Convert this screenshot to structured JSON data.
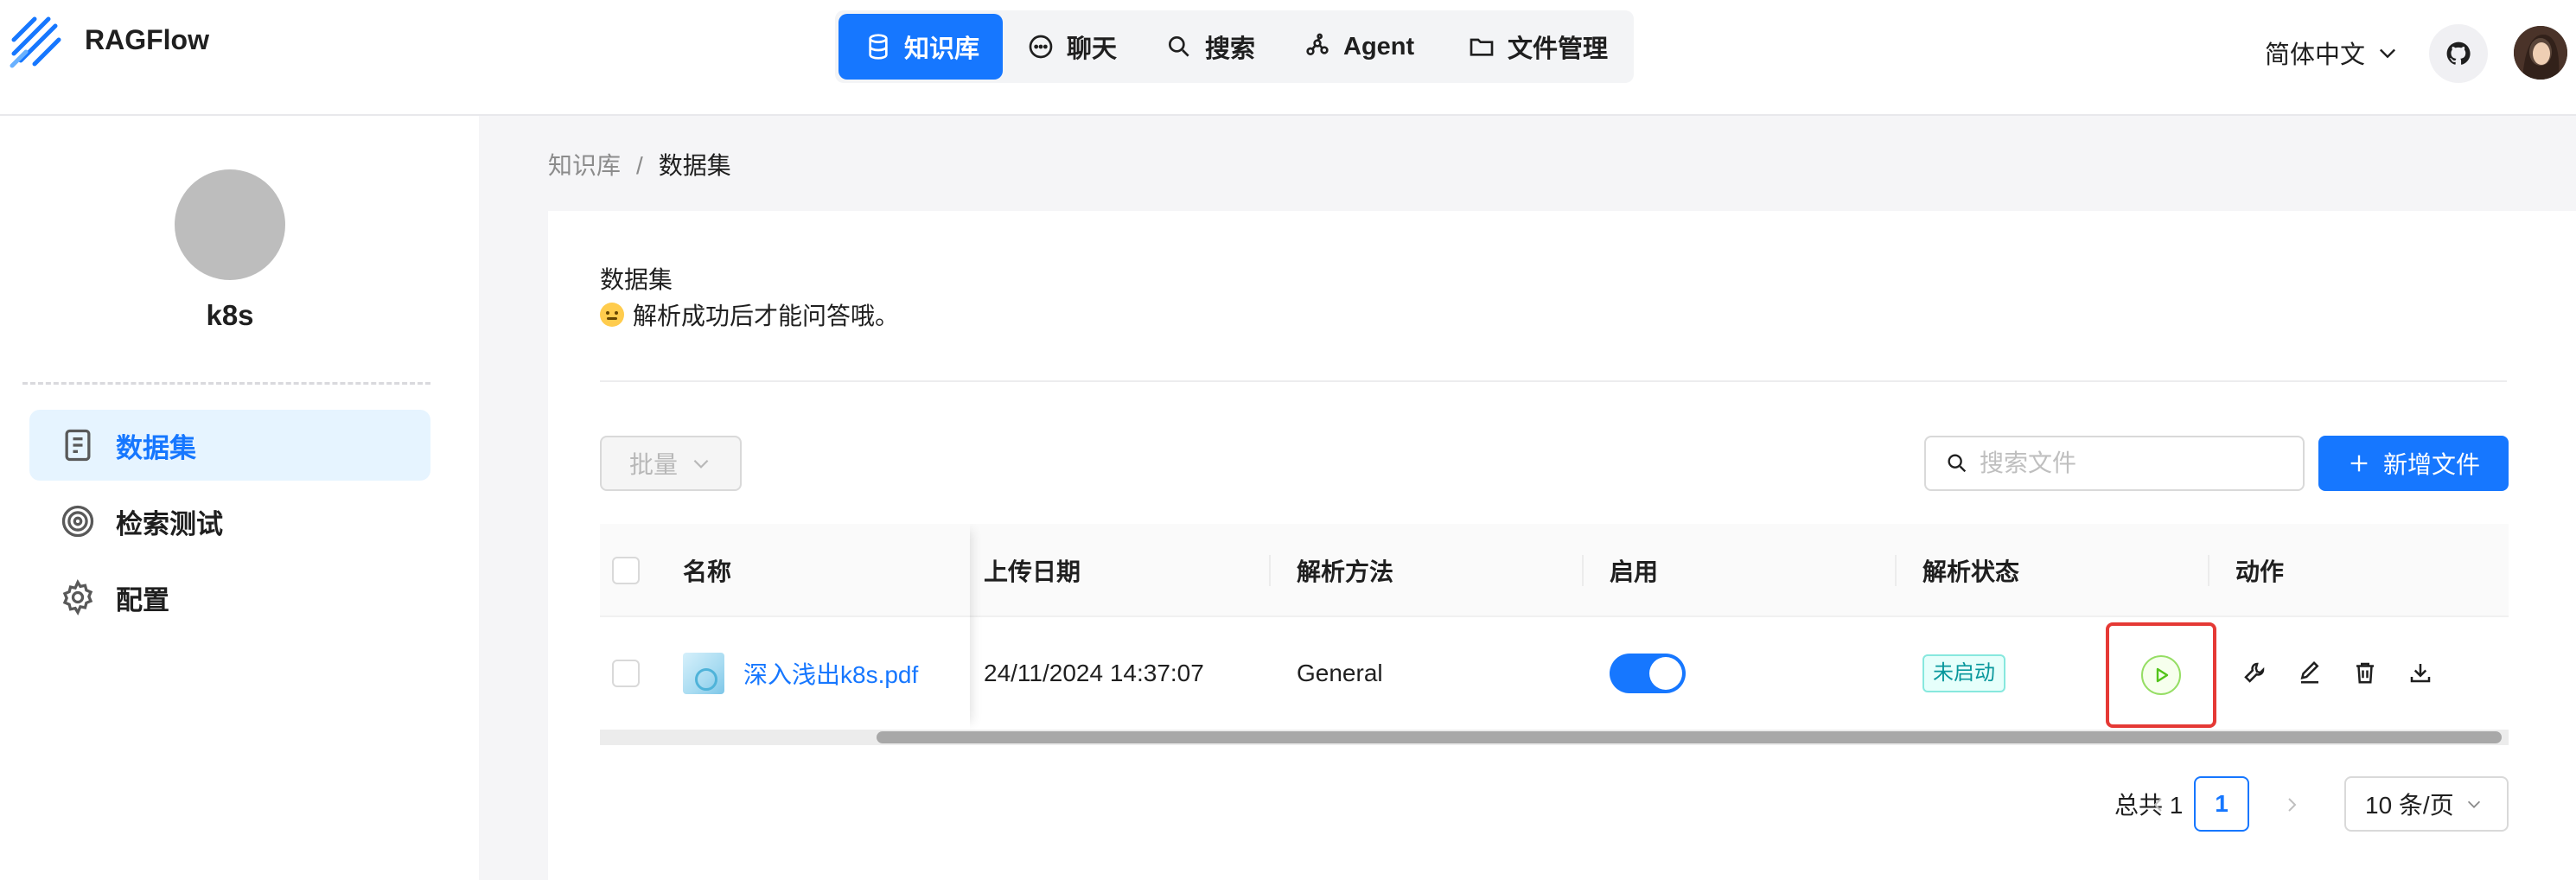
{
  "app": {
    "brand": "RAGFlow",
    "colors": {
      "accent": "#1677ff",
      "active_bg": "#e6f4ff",
      "status_tag": "#08979c",
      "highlight": "#e53935"
    }
  },
  "nav": {
    "items": [
      {
        "label": "知识库",
        "icon": "database-icon",
        "active": true
      },
      {
        "label": "聊天",
        "icon": "chat-icon",
        "active": false
      },
      {
        "label": "搜索",
        "icon": "search-icon",
        "active": false
      },
      {
        "label": "Agent",
        "icon": "agent-graph-icon",
        "active": false
      },
      {
        "label": "文件管理",
        "icon": "folder-icon",
        "active": false
      }
    ]
  },
  "header": {
    "language": "简体中文"
  },
  "sidebar": {
    "kb_name": "k8s",
    "items": [
      {
        "label": "数据集",
        "icon": "document-icon",
        "active": true
      },
      {
        "label": "检索测试",
        "icon": "target-icon",
        "active": false
      },
      {
        "label": "配置",
        "icon": "gear-icon",
        "active": false
      }
    ]
  },
  "breadcrumb": {
    "root": "知识库",
    "separator": "/",
    "current": "数据集"
  },
  "dataset": {
    "title": "数据集",
    "description": "解析成功后才能问答哦。"
  },
  "toolbar": {
    "batch_label": "批量",
    "search_placeholder": "搜索文件",
    "add_label": "新增文件"
  },
  "table": {
    "headers": {
      "name": "名称",
      "upload_date": "上传日期",
      "parse_method": "解析方法",
      "enabled": "启用",
      "parse_status": "解析状态",
      "actions": "动作"
    },
    "rows": [
      {
        "name": "深入浅出k8s.pdf",
        "upload_date": "24/11/2024 14:37:07",
        "parse_method": "General",
        "enabled": true,
        "parse_status": "未启动"
      }
    ]
  },
  "pagination": {
    "total": "总共 1",
    "current_page": "1",
    "page_size": "10 条/页"
  }
}
